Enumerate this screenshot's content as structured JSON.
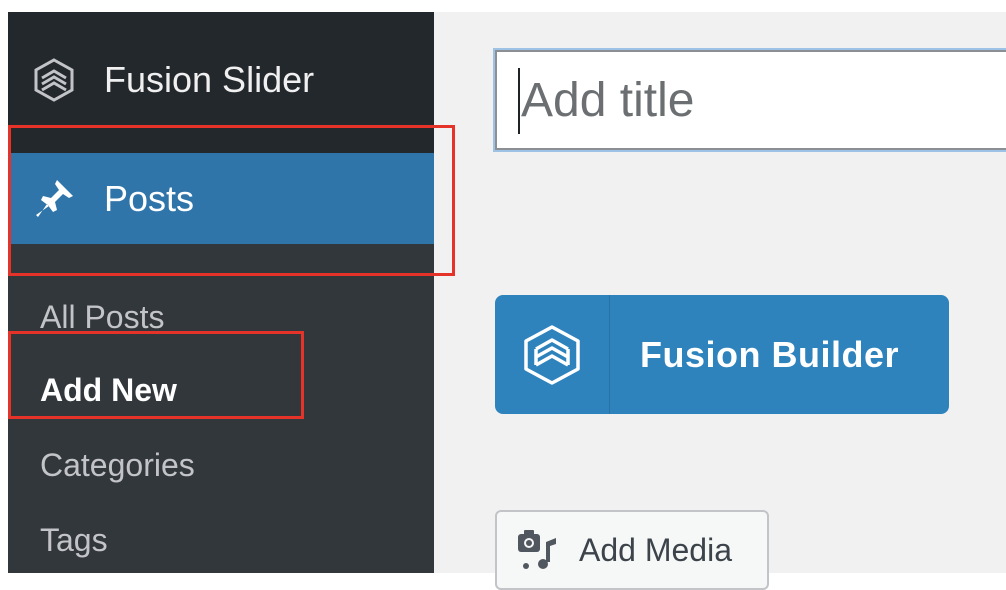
{
  "sidebar": {
    "fusion_slider": {
      "label": "Fusion Slider",
      "icon": "fusion-slider-icon"
    },
    "posts": {
      "label": "Posts",
      "icon": "pushpin-icon"
    },
    "submenu": [
      {
        "label": "All Posts",
        "current": false
      },
      {
        "label": "Add New",
        "current": true
      },
      {
        "label": "Categories",
        "current": false
      },
      {
        "label": "Tags",
        "current": false
      }
    ]
  },
  "editor": {
    "title_placeholder": "Add title",
    "fusion_builder_label": "Fusion Builder",
    "fusion_builder_icon": "fusion-builder-icon",
    "add_media_label": "Add Media",
    "add_media_icon": "media-icon"
  },
  "colors": {
    "sidebar_bg": "#23282d",
    "submenu_bg": "#32373c",
    "active_menu": "#2f75aa",
    "builder_button": "#2e83bd",
    "highlight": "#e5332a"
  }
}
